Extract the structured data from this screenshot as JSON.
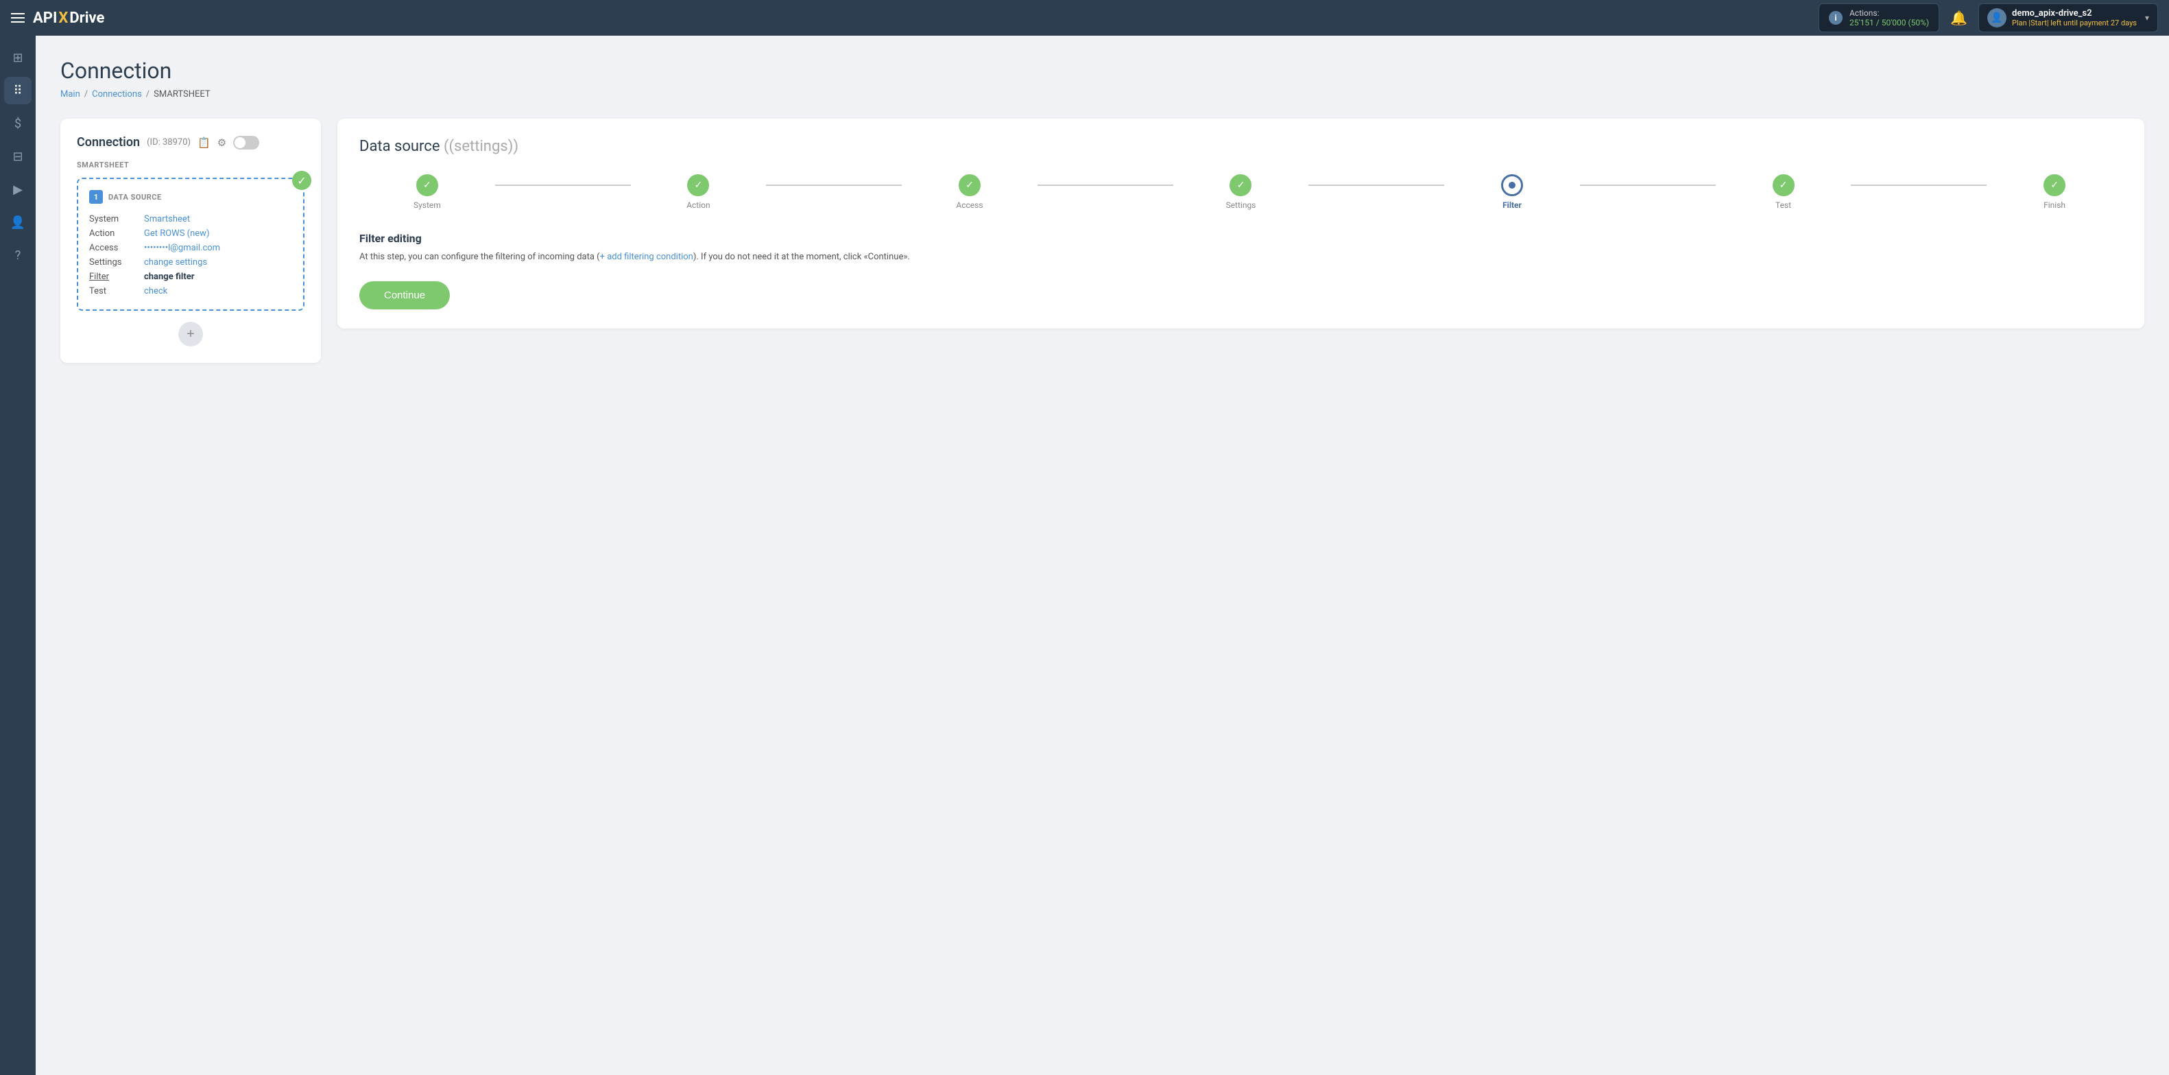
{
  "topNav": {
    "hamburger_label": "menu",
    "logo": {
      "api": "API",
      "x": "X",
      "drive": "Drive"
    },
    "actions": {
      "label": "Actions:",
      "count": "25'151",
      "total": "50'000",
      "percent": "50%",
      "info_icon": "i"
    },
    "user": {
      "name": "demo_apix-drive_s2",
      "plan_prefix": "Plan |",
      "plan_name": "Start",
      "plan_suffix": "| left until payment",
      "days": "27 days",
      "avatar_icon": "👤"
    }
  },
  "sidebar": {
    "items": [
      {
        "icon": "⊞",
        "label": "dashboard",
        "active": false
      },
      {
        "icon": "⠿",
        "label": "connections",
        "active": true
      },
      {
        "icon": "$",
        "label": "billing",
        "active": false
      },
      {
        "icon": "⊟",
        "label": "templates",
        "active": false
      },
      {
        "icon": "▶",
        "label": "runs",
        "active": false
      },
      {
        "icon": "👤",
        "label": "account",
        "active": false
      },
      {
        "icon": "?",
        "label": "help",
        "active": false
      }
    ]
  },
  "page": {
    "title": "Connection",
    "breadcrumb": {
      "main": "Main",
      "connections": "Connections",
      "current": "SMARTSHEET"
    }
  },
  "leftPanel": {
    "conn_title": "Connection",
    "conn_id": "(ID: 38970)",
    "subtitle": "SMARTSHEET",
    "datasource": {
      "number": "1",
      "label": "DATA SOURCE",
      "rows": [
        {
          "key": "System",
          "value": "Smartsheet",
          "style": "link"
        },
        {
          "key": "Action",
          "value": "Get ROWS (new)",
          "style": "link"
        },
        {
          "key": "Access",
          "value": "••••••••l@gmail.com",
          "style": "link"
        },
        {
          "key": "Settings",
          "value": "change settings",
          "style": "link"
        },
        {
          "key": "Filter",
          "value": "change filter",
          "style": "bold-link",
          "key_style": "filter-link"
        },
        {
          "key": "Test",
          "value": "check",
          "style": "link"
        }
      ]
    },
    "add_btn": "+"
  },
  "rightPanel": {
    "title": "Data source",
    "title_sub": "(settings)",
    "steps": [
      {
        "label": "System",
        "done": true,
        "active": false
      },
      {
        "label": "Action",
        "done": true,
        "active": false
      },
      {
        "label": "Access",
        "done": true,
        "active": false
      },
      {
        "label": "Settings",
        "done": true,
        "active": false
      },
      {
        "label": "Filter",
        "done": false,
        "active": true
      },
      {
        "label": "Test",
        "done": true,
        "active": false
      },
      {
        "label": "Finish",
        "done": true,
        "active": false
      }
    ],
    "filter": {
      "title": "Filter editing",
      "desc_before": "At this step, you can configure the filtering of incoming data (",
      "desc_link": "+ add filtering condition",
      "desc_after": "). If you do not need it at the moment, click «Continue».",
      "continue_btn": "Continue"
    }
  }
}
